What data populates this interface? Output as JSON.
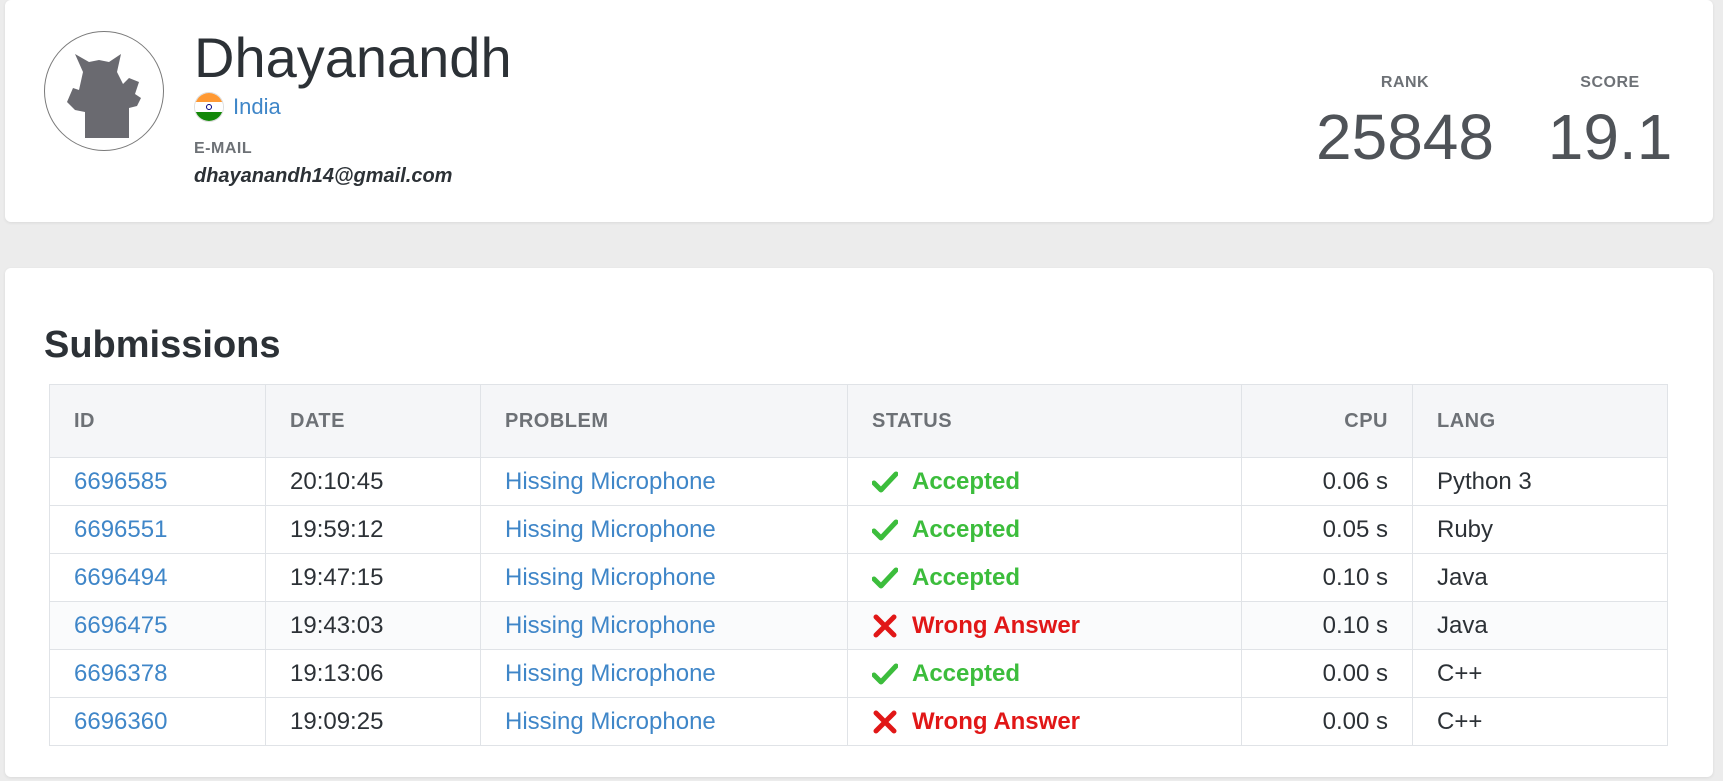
{
  "profile": {
    "name": "Dhayanandh",
    "country": "India",
    "email_label": "E-MAIL",
    "email": "dhayanandh14@gmail.com",
    "rank_label": "RANK",
    "rank": "25848",
    "score_label": "SCORE",
    "score": "19.1"
  },
  "submissions": {
    "title": "Submissions",
    "columns": {
      "id": "ID",
      "date": "DATE",
      "problem": "PROBLEM",
      "status": "STATUS",
      "cpu": "CPU",
      "lang": "LANG"
    },
    "rows": [
      {
        "id": "6696585",
        "date": "20:10:45",
        "problem": "Hissing Microphone",
        "status": "Accepted",
        "cpu": "0.06 s",
        "lang": "Python 3"
      },
      {
        "id": "6696551",
        "date": "19:59:12",
        "problem": "Hissing Microphone",
        "status": "Accepted",
        "cpu": "0.05 s",
        "lang": "Ruby"
      },
      {
        "id": "6696494",
        "date": "19:47:15",
        "problem": "Hissing Microphone",
        "status": "Accepted",
        "cpu": "0.10 s",
        "lang": "Java"
      },
      {
        "id": "6696475",
        "date": "19:43:03",
        "problem": "Hissing Microphone",
        "status": "Wrong Answer",
        "cpu": "0.10 s",
        "lang": "Java"
      },
      {
        "id": "6696378",
        "date": "19:13:06",
        "problem": "Hissing Microphone",
        "status": "Accepted",
        "cpu": "0.00 s",
        "lang": "C++"
      },
      {
        "id": "6696360",
        "date": "19:09:25",
        "problem": "Hissing Microphone",
        "status": "Wrong Answer",
        "cpu": "0.00 s",
        "lang": "C++"
      }
    ]
  },
  "colors": {
    "link": "#3f86c8",
    "accepted": "#3cbd3c",
    "wrong": "#e11717"
  },
  "icons": {
    "accepted": "check-icon",
    "wrong": "cross-icon"
  }
}
